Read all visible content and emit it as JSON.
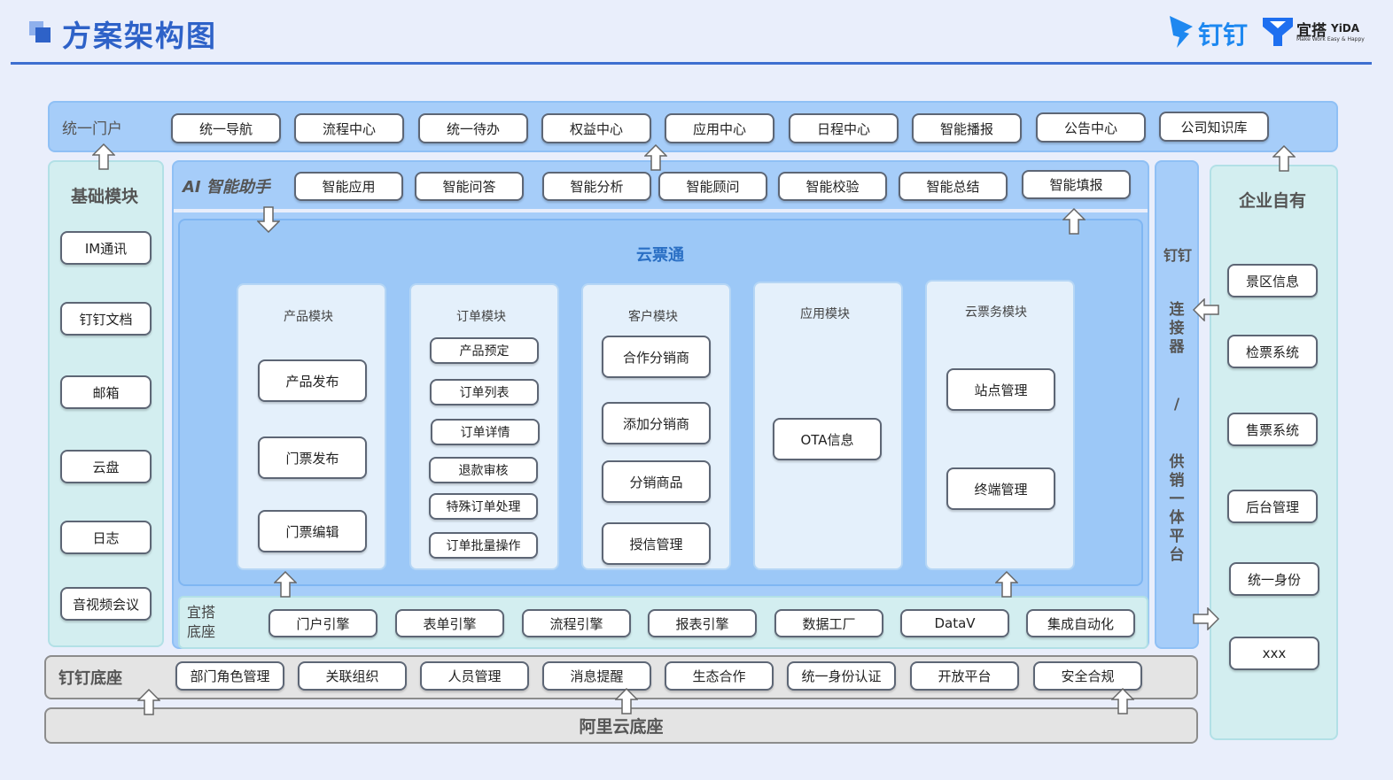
{
  "header": {
    "title": "方案架构图",
    "dingtalk_brand": "钉钉",
    "yida_brand_cn": "宜搭",
    "yida_brand_en": "YiDA",
    "yida_slogan": "Make Work Easy & Happy"
  },
  "portal": {
    "label": "统一门户",
    "items": [
      "统一导航",
      "流程中心",
      "统一待办",
      "权益中心",
      "应用中心",
      "日程中心",
      "智能播报",
      "公告中心",
      "公司知识库"
    ]
  },
  "basic": {
    "label": "基础模块",
    "items": [
      "IM通讯",
      "钉钉文档",
      "邮箱",
      "云盘",
      "日志",
      "音视频会议"
    ]
  },
  "ai": {
    "label": "AI 智能助手",
    "items": [
      "智能应用",
      "智能问答",
      "智能分析",
      "智能顾问",
      "智能校验",
      "智能总结",
      "智能填报"
    ]
  },
  "cloud": {
    "label": "云票通",
    "modules": [
      {
        "title": "产品模块",
        "items": [
          "产品发布",
          "门票发布",
          "门票编辑"
        ]
      },
      {
        "title": "订单模块",
        "items": [
          "产品预定",
          "订单列表",
          "订单详情",
          "退款审核",
          "特殊订单处理",
          "订单批量操作"
        ]
      },
      {
        "title": "客户模块",
        "items": [
          "合作分销商",
          "添加分销商",
          "分销商品",
          "授信管理"
        ]
      },
      {
        "title": "应用模块",
        "items": [
          "OTA信息"
        ]
      },
      {
        "title": "云票务模块",
        "items": [
          "站点管理",
          "终端管理"
        ]
      }
    ]
  },
  "yida": {
    "label_line1": "宜搭",
    "label_line2": "底座",
    "items": [
      "门户引擎",
      "表单引擎",
      "流程引擎",
      "报表引擎",
      "数据工厂",
      "DataV",
      "集成自动化"
    ]
  },
  "connector": {
    "line1": "钉钉",
    "line2": "连接器",
    "slash": "/",
    "line3": "供销一体平台"
  },
  "enterprise": {
    "label": "企业自有",
    "items": [
      "景区信息",
      "检票系统",
      "售票系统",
      "后台管理",
      "统一身份",
      "xxx"
    ]
  },
  "dingbase": {
    "label": "钉钉底座",
    "items": [
      "部门角色管理",
      "关联组织",
      "人员管理",
      "消息提醒",
      "生态合作",
      "统一身份认证",
      "开放平台",
      "安全合规"
    ]
  },
  "alibase": {
    "label": "阿里云底座"
  },
  "colors": {
    "title_blue": "#2e62c8",
    "panel_blue": "#a6cdf9",
    "panel_inner": "#e4f0fb",
    "teal_panel": "#d3eef0",
    "grey_panel": "#e4e4e4"
  }
}
